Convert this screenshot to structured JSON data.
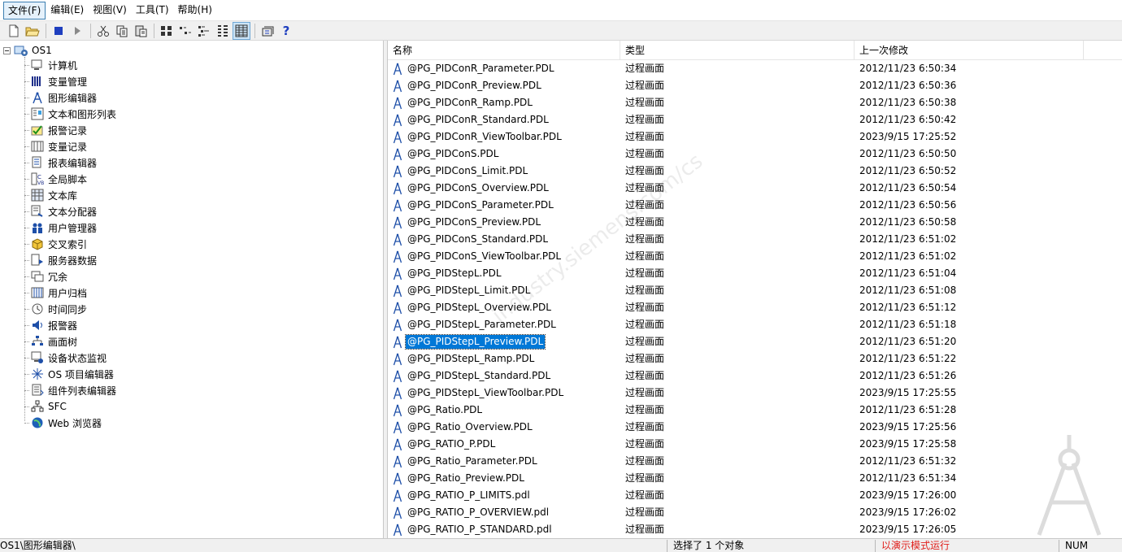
{
  "menu": [
    "文件(F)",
    "编辑(E)",
    "视图(V)",
    "工具(T)",
    "帮助(H)"
  ],
  "toolbar": {
    "buttons": [
      "new-icon",
      "open-icon",
      "stop-icon",
      "run-icon",
      "cut-icon",
      "copy-icon",
      "paste-icon",
      "large-icons-icon",
      "small-icons-icon",
      "list-view-icon",
      "details-icon",
      "properties-icon",
      "help-icon"
    ],
    "help_label": "?"
  },
  "tree": {
    "root": "OS1",
    "items": [
      {
        "label": "计算机",
        "icon": "computer-icon"
      },
      {
        "label": "变量管理",
        "icon": "tag-management-icon"
      },
      {
        "label": "图形编辑器",
        "icon": "graphics-designer-icon"
      },
      {
        "label": "文本和图形列表",
        "icon": "text-graphic-list-icon"
      },
      {
        "label": "报警记录",
        "icon": "alarm-logging-icon"
      },
      {
        "label": "变量记录",
        "icon": "tag-logging-icon"
      },
      {
        "label": "报表编辑器",
        "icon": "report-designer-icon"
      },
      {
        "label": "全局脚本",
        "icon": "global-script-icon"
      },
      {
        "label": "文本库",
        "icon": "text-library-icon"
      },
      {
        "label": "文本分配器",
        "icon": "text-distributor-icon"
      },
      {
        "label": "用户管理器",
        "icon": "user-administrator-icon"
      },
      {
        "label": "交叉索引",
        "icon": "cross-reference-icon"
      },
      {
        "label": "服务器数据",
        "icon": "server-data-icon"
      },
      {
        "label": "冗余",
        "icon": "redundancy-icon"
      },
      {
        "label": "用户归档",
        "icon": "user-archive-icon"
      },
      {
        "label": "时间同步",
        "icon": "time-sync-icon"
      },
      {
        "label": "报警器",
        "icon": "horn-icon"
      },
      {
        "label": "画面树",
        "icon": "picture-tree-icon"
      },
      {
        "label": "设备状态监视",
        "icon": "lifebeat-monitoring-icon"
      },
      {
        "label": "OS 项目编辑器",
        "icon": "os-project-editor-icon"
      },
      {
        "label": "组件列表编辑器",
        "icon": "component-list-editor-icon"
      },
      {
        "label": "SFC",
        "icon": "sfc-icon"
      },
      {
        "label": "Web 浏览器",
        "icon": "web-navigator-icon"
      }
    ]
  },
  "list": {
    "columns": [
      "名称",
      "类型",
      "上一次修改"
    ],
    "rows": [
      {
        "name": "@PG_PIDConR_Parameter.PDL",
        "type": "过程画面",
        "modified": "2012/11/23 6:50:34"
      },
      {
        "name": "@PG_PIDConR_Preview.PDL",
        "type": "过程画面",
        "modified": "2012/11/23 6:50:36"
      },
      {
        "name": "@PG_PIDConR_Ramp.PDL",
        "type": "过程画面",
        "modified": "2012/11/23 6:50:38"
      },
      {
        "name": "@PG_PIDConR_Standard.PDL",
        "type": "过程画面",
        "modified": "2012/11/23 6:50:42"
      },
      {
        "name": "@PG_PIDConR_ViewToolbar.PDL",
        "type": "过程画面",
        "modified": "2023/9/15 17:25:52"
      },
      {
        "name": "@PG_PIDConS.PDL",
        "type": "过程画面",
        "modified": "2012/11/23 6:50:50"
      },
      {
        "name": "@PG_PIDConS_Limit.PDL",
        "type": "过程画面",
        "modified": "2012/11/23 6:50:52"
      },
      {
        "name": "@PG_PIDConS_Overview.PDL",
        "type": "过程画面",
        "modified": "2012/11/23 6:50:54"
      },
      {
        "name": "@PG_PIDConS_Parameter.PDL",
        "type": "过程画面",
        "modified": "2012/11/23 6:50:56"
      },
      {
        "name": "@PG_PIDConS_Preview.PDL",
        "type": "过程画面",
        "modified": "2012/11/23 6:50:58"
      },
      {
        "name": "@PG_PIDConS_Standard.PDL",
        "type": "过程画面",
        "modified": "2012/11/23 6:51:02"
      },
      {
        "name": "@PG_PIDConS_ViewToolbar.PDL",
        "type": "过程画面",
        "modified": "2012/11/23 6:51:02"
      },
      {
        "name": "@PG_PIDStepL.PDL",
        "type": "过程画面",
        "modified": "2012/11/23 6:51:04"
      },
      {
        "name": "@PG_PIDStepL_Limit.PDL",
        "type": "过程画面",
        "modified": "2012/11/23 6:51:08"
      },
      {
        "name": "@PG_PIDStepL_Overview.PDL",
        "type": "过程画面",
        "modified": "2012/11/23 6:51:12"
      },
      {
        "name": "@PG_PIDStepL_Parameter.PDL",
        "type": "过程画面",
        "modified": "2012/11/23 6:51:18"
      },
      {
        "name": "@PG_PIDStepL_Preview.PDL",
        "type": "过程画面",
        "modified": "2012/11/23 6:51:20",
        "selected": true
      },
      {
        "name": "@PG_PIDStepL_Ramp.PDL",
        "type": "过程画面",
        "modified": "2012/11/23 6:51:22"
      },
      {
        "name": "@PG_PIDStepL_Standard.PDL",
        "type": "过程画面",
        "modified": "2012/11/23 6:51:26"
      },
      {
        "name": "@PG_PIDStepL_ViewToolbar.PDL",
        "type": "过程画面",
        "modified": "2023/9/15 17:25:55"
      },
      {
        "name": "@PG_Ratio.PDL",
        "type": "过程画面",
        "modified": "2012/11/23 6:51:28"
      },
      {
        "name": "@PG_Ratio_Overview.PDL",
        "type": "过程画面",
        "modified": "2023/9/15 17:25:56"
      },
      {
        "name": "@PG_RATIO_P.PDL",
        "type": "过程画面",
        "modified": "2023/9/15 17:25:58"
      },
      {
        "name": "@PG_Ratio_Parameter.PDL",
        "type": "过程画面",
        "modified": "2012/11/23 6:51:32"
      },
      {
        "name": "@PG_Ratio_Preview.PDL",
        "type": "过程画面",
        "modified": "2012/11/23 6:51:34"
      },
      {
        "name": "@PG_RATIO_P_LIMITS.pdl",
        "type": "过程画面",
        "modified": "2023/9/15 17:26:00"
      },
      {
        "name": "@PG_RATIO_P_OVERVIEW.pdl",
        "type": "过程画面",
        "modified": "2023/9/15 17:26:02"
      },
      {
        "name": "@PG_RATIO_P_STANDARD.pdl",
        "type": "过程画面",
        "modified": "2023/9/15 17:26:05"
      }
    ]
  },
  "status": {
    "path": "OS1\\图形编辑器\\",
    "selection": "选择了 1 个对象",
    "mode": "以演示模式运行",
    "num": "NUM"
  },
  "colors": {
    "selection": "#0078d7",
    "mode_text": "#e0201c",
    "icon_blue": "#1e4fa8"
  }
}
